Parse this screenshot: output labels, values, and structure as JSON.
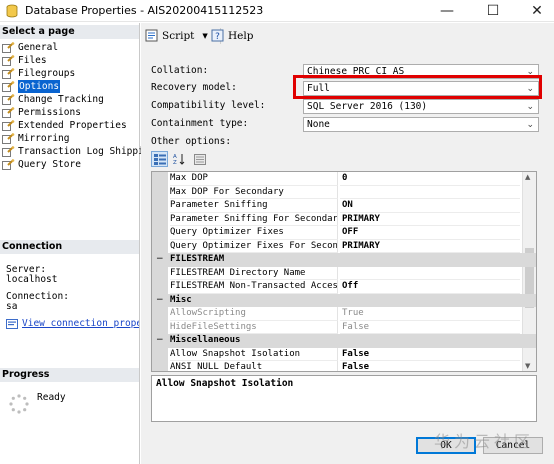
{
  "window": {
    "title": "Database Properties - AIS20200415112523",
    "minimize": "—",
    "maximize": "☐",
    "close": "✕"
  },
  "left": {
    "select_page_header": "Select a page",
    "pages": [
      {
        "label": "General",
        "selected": false
      },
      {
        "label": "Files",
        "selected": false
      },
      {
        "label": "Filegroups",
        "selected": false
      },
      {
        "label": "Options",
        "selected": true
      },
      {
        "label": "Change Tracking",
        "selected": false
      },
      {
        "label": "Permissions",
        "selected": false
      },
      {
        "label": "Extended Properties",
        "selected": false
      },
      {
        "label": "Mirroring",
        "selected": false
      },
      {
        "label": "Transaction Log Shipping",
        "selected": false
      },
      {
        "label": "Query Store",
        "selected": false
      }
    ],
    "connection_header": "Connection",
    "server_label": "Server:",
    "server_value": "localhost",
    "connection_label": "Connection:",
    "connection_value": "sa",
    "view_link": "View connection properties",
    "progress_header": "Progress",
    "progress_status": "Ready"
  },
  "toolbar": {
    "script_label": "Script",
    "help_label": "Help"
  },
  "form": {
    "collation_label": "Collation:",
    "collation_value": "Chinese_PRC_CI_AS",
    "recovery_label": "Recovery model:",
    "recovery_value": "Full",
    "compat_label": "Compatibility level:",
    "compat_value": "SQL Server 2016 (130)",
    "containment_label": "Containment type:",
    "containment_value": "None",
    "other_options_label": "Other options:"
  },
  "grid": {
    "rows": [
      {
        "type": "prop",
        "name": "Max DOP",
        "value": "0"
      },
      {
        "type": "prop",
        "name": "Max DOP For Secondary",
        "value": ""
      },
      {
        "type": "prop",
        "name": "Parameter Sniffing",
        "value": "ON"
      },
      {
        "type": "prop",
        "name": "Parameter Sniffing For Secondary",
        "value": "PRIMARY"
      },
      {
        "type": "prop",
        "name": "Query Optimizer Fixes",
        "value": "OFF"
      },
      {
        "type": "prop",
        "name": "Query Optimizer Fixes For Secondary",
        "value": "PRIMARY"
      },
      {
        "type": "cat",
        "name": "FILESTREAM"
      },
      {
        "type": "prop",
        "name": "FILESTREAM Directory Name",
        "value": ""
      },
      {
        "type": "prop",
        "name": "FILESTREAM Non-Transacted Access",
        "value": "Off"
      },
      {
        "type": "cat",
        "name": "Misc"
      },
      {
        "type": "prop",
        "name": "AllowScripting",
        "value": "True",
        "disabled": true
      },
      {
        "type": "prop",
        "name": "HideFileSettings",
        "value": "False",
        "disabled": true
      },
      {
        "type": "cat",
        "name": "Miscellaneous"
      },
      {
        "type": "prop",
        "name": "Allow Snapshot Isolation",
        "value": "False"
      },
      {
        "type": "prop",
        "name": "ANSI NULL Default",
        "value": "False"
      }
    ],
    "description": "Allow Snapshot Isolation"
  },
  "buttons": {
    "ok": "OK",
    "cancel": "Cancel"
  },
  "watermark": "华为云社区",
  "colors": {
    "selection": "#0a64d0",
    "highlight_box": "#e00000",
    "link": "#1a46c8"
  }
}
